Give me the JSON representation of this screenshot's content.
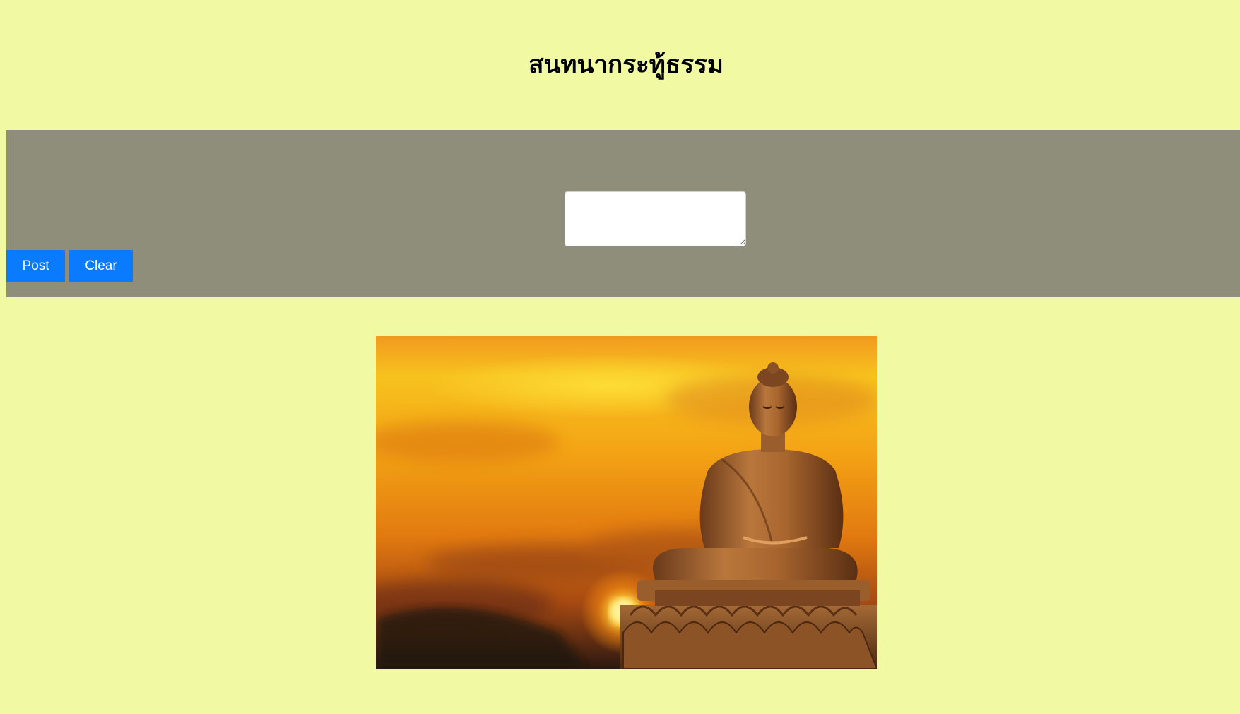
{
  "header": {
    "title": "สนทนากระทู้ธรรม"
  },
  "composer": {
    "message_value": "",
    "message_placeholder": "",
    "post_label": "Post",
    "clear_label": "Clear"
  },
  "colors": {
    "page_background": "#f1f9a3",
    "panel_background": "#8e8e7b",
    "button_background": "#0a7bff",
    "button_text": "#ffffff"
  },
  "image": {
    "subject": "buddha-statue-sunset"
  }
}
